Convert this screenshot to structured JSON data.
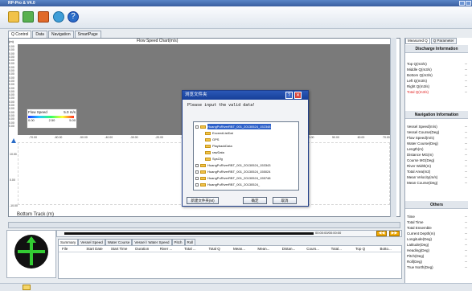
{
  "window": {
    "title": "RP-Pro & V4.0"
  },
  "main_tabs": [
    "Q Control",
    "Data",
    "Navigation",
    "SmartPage"
  ],
  "chart": {
    "title": "Flow Speed Chart(m/s)",
    "y_unit": "(m)",
    "y_ticks": [
      "0.00",
      "0.00",
      "0.00",
      "0.00",
      "0.00",
      "0.00",
      "0.00",
      "0.00",
      "0.00",
      "0.00",
      "0.00",
      "0.00",
      "0.00",
      "0.00",
      "0.00",
      "0.00",
      "0.00",
      "0.00",
      "0.00",
      "0.00",
      "0.00",
      "0.00",
      "0.00",
      "0.00"
    ],
    "x_ticks": [
      "-70.00",
      "-60.00",
      "-50.00",
      "-40.00",
      "-30.00",
      "-20.00",
      "-10.00",
      "0.00",
      "10.00",
      "20.00",
      "30.00",
      "40.00",
      "50.00",
      "60.00",
      "70.00"
    ],
    "lower_y_ticks": [
      "10.00",
      "0.00",
      "-10.00"
    ],
    "legend": {
      "title": "Flow Speed",
      "max_label": "5.0 m/s",
      "scale_labels": [
        "0.00",
        "2.50",
        "5.00"
      ]
    },
    "bottom_label": "Bottom Track (m)"
  },
  "dialog": {
    "title": "浏览文件夹",
    "prompt": "Please input the valid data!",
    "tree": [
      {
        "label": "HuangPuRiverRBT_001_20130524_152348",
        "selected": true,
        "expanded": true
      },
      {
        "label": "ExceedListDat",
        "child": true
      },
      {
        "label": "GPS",
        "child": true
      },
      {
        "label": "PlaybackData",
        "child": true
      },
      {
        "label": "rawData",
        "child": true
      },
      {
        "label": "SysCfg",
        "child": true
      },
      {
        "label": "HuangPuRiverRBT_001_20130524_153343"
      },
      {
        "label": "HuangPuRiverRBT_001_20130524_155024"
      },
      {
        "label": "HuangPuRiverRBT_001_20130524_155748"
      },
      {
        "label": "HuangPuRiverRBT_001_20130524_"
      }
    ],
    "new_folder_label": "新建文件夹(M)",
    "ok_label": "确定",
    "cancel_label": "取消",
    "help_label": "?",
    "close_label": "✕"
  },
  "right_panel": {
    "tabs": [
      "Measured Q",
      "Q Parameter"
    ],
    "discharge": {
      "header": "Discharge Information",
      "items": [
        {
          "label": "Top Q(m3/s)",
          "value": "--"
        },
        {
          "label": "Middle Q(m3/s)",
          "value": "--"
        },
        {
          "label": "Bottom Q(m3/s)",
          "value": "--"
        },
        {
          "label": "Left Q(m3/s)",
          "value": "--"
        },
        {
          "label": "Right Q(m3/s)",
          "value": "--"
        },
        {
          "label": "Total Q(m3/s)",
          "value": "--"
        }
      ]
    },
    "navigation": {
      "header": "Navigation Information",
      "items": [
        {
          "label": "Vessel Speed(m/s)",
          "value": "--"
        },
        {
          "label": "Vessel Course(Deg)",
          "value": "--"
        },
        {
          "label": "Flow Speed(m/s)",
          "value": "--"
        },
        {
          "label": "Water Course(Deg)",
          "value": "--"
        },
        {
          "label": "Length(m)",
          "value": "--"
        },
        {
          "label": "Distance MG(m)",
          "value": "--"
        },
        {
          "label": "Course MG(Deg)",
          "value": "--"
        },
        {
          "label": "River Width(m)",
          "value": "--"
        },
        {
          "label": "Total Area(m2)",
          "value": "--"
        },
        {
          "label": "Mean Velocity(m/s)",
          "value": "--"
        },
        {
          "label": "Mean Course(Deg)",
          "value": "--"
        }
      ]
    },
    "others": {
      "header": "Others",
      "items": [
        {
          "label": "Time",
          "value": "--"
        },
        {
          "label": "Total Time",
          "value": "--"
        },
        {
          "label": "Total Ensemble",
          "value": "--"
        },
        {
          "label": "Current Depth(m)",
          "value": "--"
        },
        {
          "label": "Longitude(Deg)",
          "value": "--"
        },
        {
          "label": "Latitude(Deg)",
          "value": "--"
        },
        {
          "label": "Heading(Deg)",
          "value": "--"
        },
        {
          "label": "Pitch(Deg)",
          "value": "--"
        },
        {
          "label": "Roll(Deg)",
          "value": "--"
        },
        {
          "label": "True North(Deg)",
          "value": "--"
        }
      ]
    }
  },
  "playback": {
    "time": "00:00:00/00:00:00",
    "rewind_label": "◀◀",
    "forward_label": "▶▶"
  },
  "bottom_tabs": [
    "Summary",
    "Vessel Speed",
    "Water Course",
    "Vessel / Water Speed",
    "Pitch",
    "Roll"
  ],
  "table_columns": [
    "File",
    "Start Date",
    "Start Time",
    "Duration",
    "River ...",
    "Total ...",
    "Total Q",
    "Mean...",
    "Mean...",
    "Distan...",
    "Cours...",
    "Total...",
    "Top Q",
    "Botto..."
  ],
  "colors": {
    "accent": "#2b58b6",
    "legend_red": "#ff3322",
    "legend_blue": "#1e3cff",
    "play_button": "#f0a800",
    "compass_arrow": "#33cc33"
  },
  "icons": [
    "open-folder-icon",
    "upload-icon",
    "home-icon",
    "refresh-icon",
    "help-icon"
  ]
}
